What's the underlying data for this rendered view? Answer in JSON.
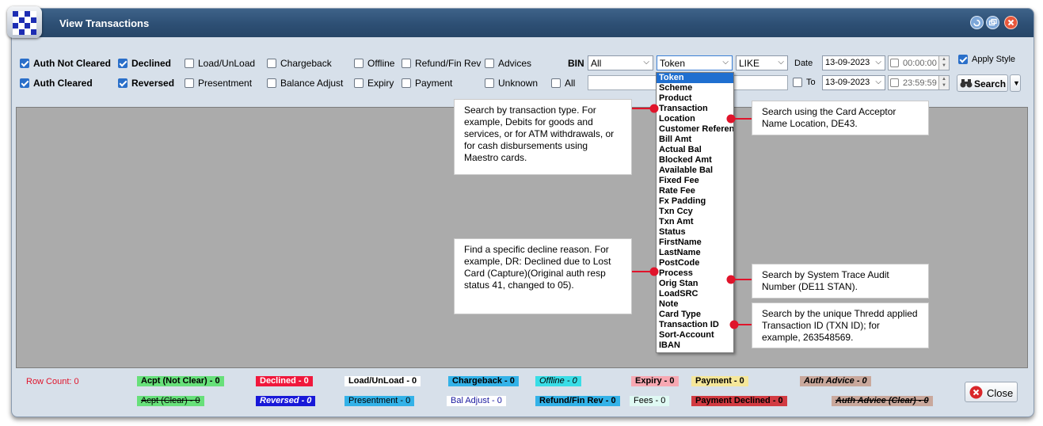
{
  "window": {
    "title": "View Transactions"
  },
  "filters": {
    "row1": [
      {
        "label": "Auth Not Cleared",
        "checked": true,
        "bold": true
      },
      {
        "label": "Declined",
        "checked": true,
        "bold": true
      },
      {
        "label": "Load/UnLoad",
        "checked": false
      },
      {
        "label": "Chargeback",
        "checked": false
      },
      {
        "label": "Offline",
        "checked": false
      },
      {
        "label": "Refund/Fin Rev",
        "checked": false
      },
      {
        "label": "Advices",
        "checked": false
      }
    ],
    "row2": [
      {
        "label": "Auth Cleared",
        "checked": true,
        "bold": true
      },
      {
        "label": "Reversed",
        "checked": true,
        "bold": true
      },
      {
        "label": "Presentment",
        "checked": false
      },
      {
        "label": "Balance Adjust",
        "checked": false
      },
      {
        "label": "Expiry",
        "checked": false
      },
      {
        "label": "Payment",
        "checked": false
      },
      {
        "label": "Unknown",
        "checked": false
      },
      {
        "label": "All",
        "checked": false
      }
    ]
  },
  "search": {
    "bin_label": "BIN",
    "bin_value": "All",
    "field_value": "Token",
    "operator_value": "LIKE",
    "date_label": "Date",
    "date_from": "13-09-2023",
    "time_from": "00:00:00",
    "to_label": "To",
    "date_to": "13-09-2023",
    "time_to": "23:59:59",
    "apply_style_label": "Apply Style",
    "apply_style_checked": true,
    "search_button": "Search"
  },
  "dropdown_items": [
    "Token",
    "Scheme",
    "Product",
    "Transaction",
    "Location",
    "Customer Reference",
    "Bill Amt",
    "Actual Bal",
    "Blocked Amt",
    "Available Bal",
    "Fixed Fee",
    "Rate Fee",
    "Fx Padding",
    "Txn Ccy",
    "Txn Amt",
    "Status",
    "FirstName",
    "LastName",
    "PostCode",
    "Process",
    "Orig Stan",
    "LoadSRC",
    "Note",
    "Card Type",
    "Transaction ID",
    "Sort-Account",
    "IBAN"
  ],
  "callouts": {
    "transaction": "Search by transaction type. For example, Debits for goods and services, or for ATM withdrawals, or for cash disbursements using Maestro cards.",
    "location": "Search using the Card Acceptor Name Location, DE43.",
    "process": "Find a specific decline reason. For example, DR: Declined due to Lost Card (Capture)(Original auth resp status 41, changed to 05).",
    "orig_stan": "Search by System Trace Audit Number (DE11 STAN).",
    "txn_id": "Search by the unique Thredd applied Transaction ID (TXN ID); for example, 263548569."
  },
  "footer": {
    "row_count": "Row Count: 0",
    "badges_row1": [
      {
        "label": "Acpt (Not Clear) - 0",
        "bg": "#67e07a",
        "color": "#000000"
      },
      {
        "label": "Declined - 0",
        "bg": "#f0183c",
        "color": "#ffffff"
      },
      {
        "label": "Load/UnLoad - 0",
        "bg": "#ffffff",
        "color": "#000000"
      },
      {
        "label": "Chargeback - 0",
        "bg": "#33b2e8",
        "color": "#000000"
      },
      {
        "label": "Offline - 0",
        "bg": "#39dde6",
        "color": "#000000"
      },
      {
        "label": "Expiry - 0",
        "bg": "#f7a8b2",
        "color": "#000000"
      },
      {
        "label": "Payment - 0",
        "bg": "#f5e79a",
        "color": "#000000"
      },
      {
        "label": "Auth Advice - 0",
        "bg": "#c9a89c",
        "color": "#000000"
      }
    ],
    "badges_row2": [
      {
        "label": "Acpt (Clear) - 0",
        "bg": "#67e07a",
        "color": "#000000"
      },
      {
        "label": "Reversed - 0",
        "bg": "#1818d8",
        "color": "#ffffff"
      },
      {
        "label": "Presentment - 0",
        "bg": "#33b2e8",
        "color": "#000000"
      },
      {
        "label": "Bal Adjust - 0",
        "bg": "#ffffff",
        "color": "#1a1aa0"
      },
      {
        "label": "Refund/Fin Rev - 0",
        "bg": "#33b2e8",
        "color": "#000000"
      },
      {
        "label": "Fees - 0",
        "bg": "#dff9f3",
        "color": "#000000"
      },
      {
        "label": "Payment Declined - 0",
        "bg": "#d23b42",
        "color": "#000000"
      },
      {
        "label": "Auth Advice (Clear) - 0",
        "bg": "#c9a89c",
        "color": "#000000"
      }
    ],
    "close_button": "Close"
  }
}
